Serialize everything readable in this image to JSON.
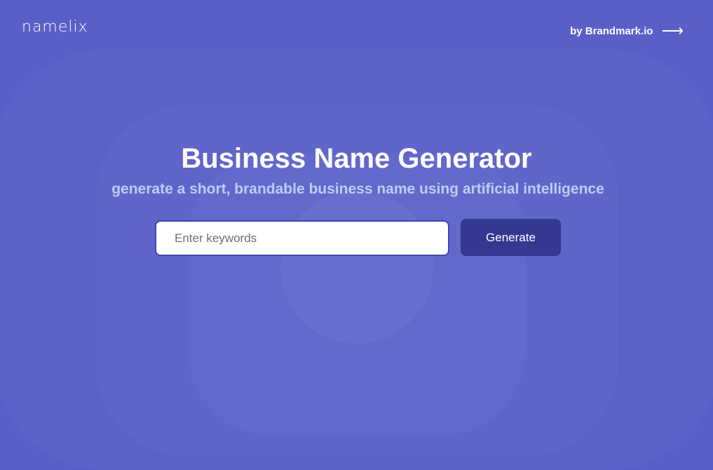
{
  "header": {
    "logo": "namelix",
    "by_link": "by Brandmark.io",
    "arrow_icon": "arrow-right-icon"
  },
  "hero": {
    "title": "Business Name Generator",
    "subtitle": "generate a short, brandable business name using artificial intelligence"
  },
  "form": {
    "placeholder": "Enter keywords",
    "value": "",
    "button": "Generate"
  },
  "colors": {
    "background": "#5a5fc8",
    "button": "#343890",
    "subtitle": "#b9cff5"
  }
}
